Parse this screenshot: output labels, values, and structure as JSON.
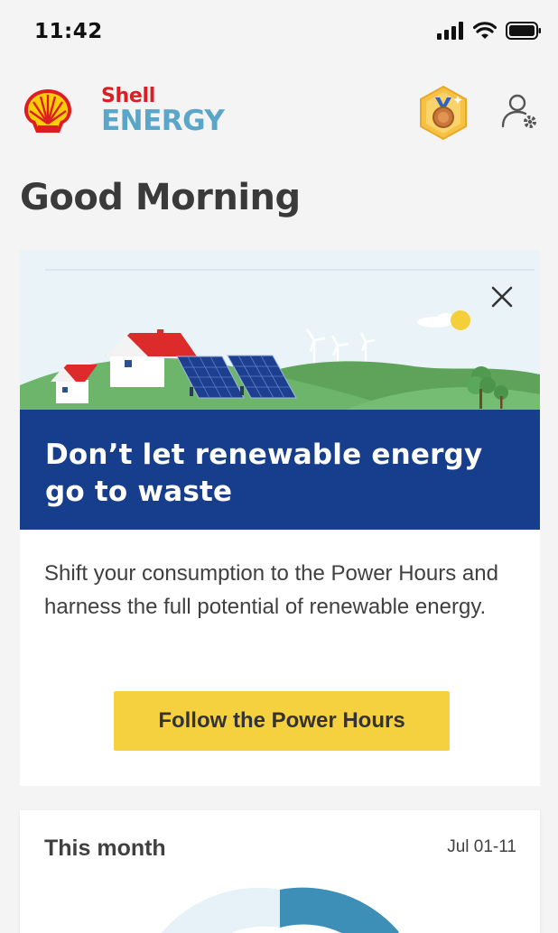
{
  "status_bar": {
    "time": "11:42"
  },
  "header": {
    "brand_top": "Shell",
    "brand_bottom": "ENERGY"
  },
  "greeting": "Good Morning",
  "promo": {
    "title": "Don’t let renewable energy go to waste",
    "body": "Shift your consumption to the Power Hours and harness the full potential of renewable energy.",
    "cta_label": "Follow the Power Hours"
  },
  "month_card": {
    "title": "This month",
    "date_range": "Jul 01-11"
  },
  "colors": {
    "background": "#f4f4f4",
    "shell_red": "#dd1d21",
    "shell_yellow": "#fbce07",
    "energy_blue": "#5aa6c8",
    "banner_navy": "#163e8c",
    "cta_yellow": "#f5d03f",
    "donut_blue": "#3d8fb8",
    "donut_light": "#e6f2f7"
  },
  "icons": {
    "signal": "cellular-signal-icon",
    "wifi": "wifi-icon",
    "battery": "battery-icon",
    "logo": "shell-pecten-logo",
    "badge": "bronze-medal-badge-icon",
    "profile": "user-settings-icon",
    "close": "close-icon"
  }
}
